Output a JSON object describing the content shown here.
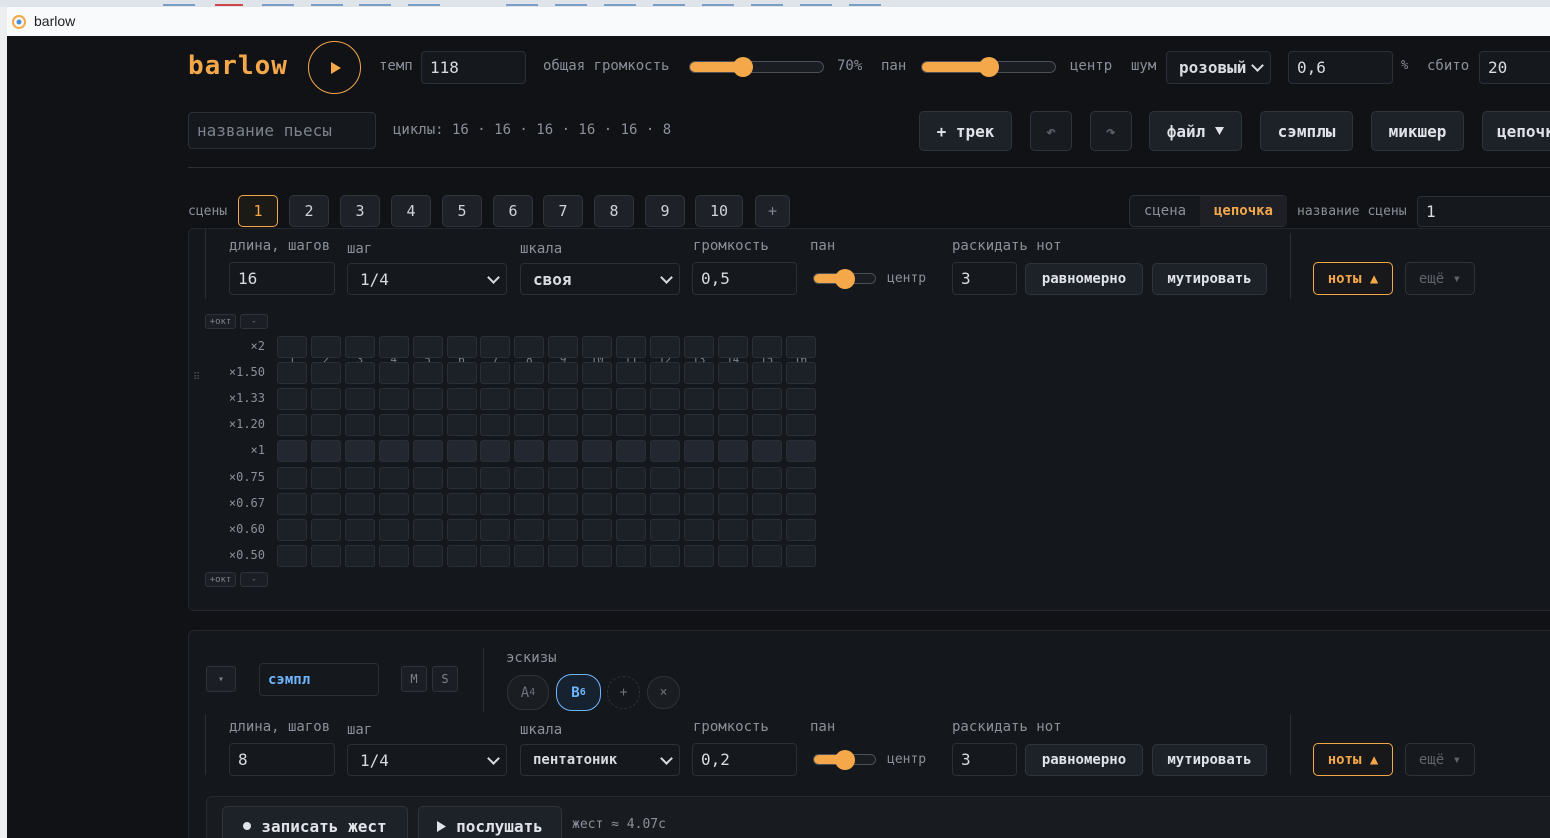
{
  "browser": {
    "tab_title": "barlow"
  },
  "header": {
    "logo": "barlow",
    "tempo_label": "темп",
    "tempo_value": "118",
    "volume_label": "общая громкость",
    "volume_value": "70%",
    "volume_level": 0.4,
    "pan_label": "пан",
    "pan_value": "центр",
    "pan_level": 0.5,
    "noise_label": "шум",
    "noise_type": "розовый",
    "noise_amount": "0,6",
    "percent_sign": "%",
    "offbeat_label": "сбито",
    "offbeat_value": "20"
  },
  "toolbar": {
    "title_placeholder": "название пьесы",
    "cycles_text": "циклы: 16 · 16 · 16 · 16 · 16 · 8",
    "add_track": "+ трек",
    "undo_icon": "↶",
    "redo_icon": "↷",
    "file": "файл",
    "samples": "сэмплы",
    "mixer": "микшер",
    "chain": "цепочка"
  },
  "scenes": {
    "label": "сцены",
    "items": [
      "1",
      "2",
      "3",
      "4",
      "5",
      "6",
      "7",
      "8",
      "9",
      "10"
    ],
    "add": "+",
    "mode_scene": "сцена",
    "mode_chain": "цепочка",
    "name_label": "название сцены",
    "name_value": "1"
  },
  "track1": {
    "length_label": "длина, шагов",
    "length_value": "16",
    "step_label": "шаг",
    "step_value": "1/4",
    "scale_label": "шкала",
    "scale_value": "своя",
    "volume_label": "громкость",
    "volume_value": "0,5",
    "pan_label": "пан",
    "pan_value": "центр",
    "pan_level": 0.5,
    "scatter_label": "раскидать нот",
    "scatter_value": "3",
    "even_button": "равномерно",
    "mutate_button": "мутировать",
    "notes_button": "ноты ▲",
    "more_button": "ещё ▾",
    "oct_up": "+окт",
    "oct_down": "-",
    "columns": [
      "1",
      "2",
      "3",
      "4",
      "5",
      "6",
      "7",
      "8",
      "9",
      "10",
      "11",
      "12",
      "13",
      "14",
      "15",
      "16"
    ],
    "rows": [
      "×2",
      "×1.50",
      "×1.33",
      "×1.20",
      "×1",
      "×0.75",
      "×0.67",
      "×0.60",
      "×0.50"
    ]
  },
  "track2": {
    "collapse_icon": "▾",
    "name_value": "сэмпл",
    "mute": "M",
    "solo": "S",
    "sketches_label": "эскизы",
    "sketch_a": "A",
    "sketch_a_sup": "4",
    "sketch_b": "B",
    "sketch_b_sup": "6",
    "sketch_add": "+",
    "sketch_remove": "×",
    "length_label": "длина, шагов",
    "length_value": "8",
    "step_label": "шаг",
    "step_value": "1/4",
    "scale_label": "шкала",
    "scale_value": "пентатоник",
    "volume_label": "громкость",
    "volume_value": "0,2",
    "pan_label": "пан",
    "pan_value": "центр",
    "pan_level": 0.5,
    "scatter_label": "раскидать нот",
    "scatter_value": "3",
    "even_button": "равномерно",
    "mutate_button": "мутировать",
    "notes_button": "ноты ▲",
    "more_button": "ещё ▾",
    "record_gesture": "записать жест",
    "listen": "послушать",
    "gesture_info": "жест ≈ 4.07с"
  },
  "colors": {
    "accent": "#f5a84a",
    "background": "#101215",
    "sketch_active": "#6fb6ff"
  }
}
